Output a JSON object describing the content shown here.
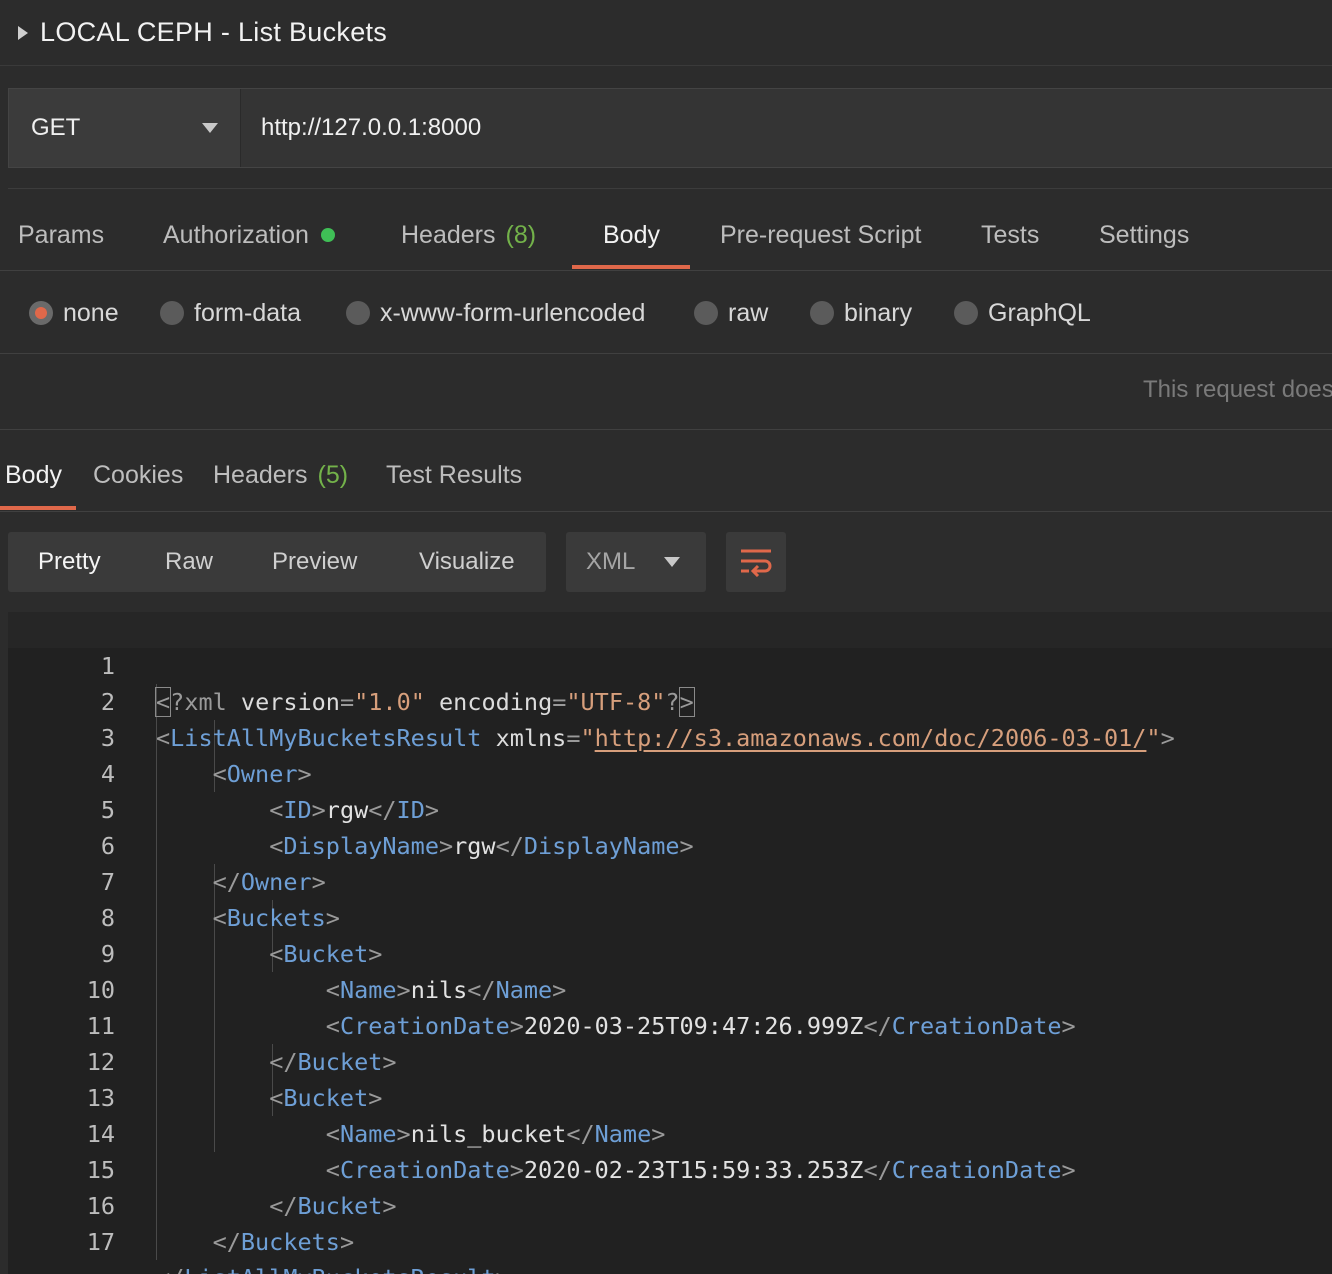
{
  "request": {
    "title": "LOCAL CEPH - List Buckets",
    "method": "GET",
    "url": "http://127.0.0.1:8000"
  },
  "request_tabs": [
    {
      "label": "Params"
    },
    {
      "label": "Authorization"
    },
    {
      "label": "Headers",
      "count": "(8)"
    },
    {
      "label": "Body"
    },
    {
      "label": "Pre-request Script"
    },
    {
      "label": "Tests"
    },
    {
      "label": "Settings"
    }
  ],
  "body_types": [
    {
      "label": "none",
      "selected": true
    },
    {
      "label": "form-data"
    },
    {
      "label": "x-www-form-urlencoded"
    },
    {
      "label": "raw"
    },
    {
      "label": "binary"
    },
    {
      "label": "GraphQL"
    }
  ],
  "body_notice": "This request does",
  "response_tabs": [
    {
      "label": "Body"
    },
    {
      "label": "Cookies"
    },
    {
      "label": "Headers",
      "count": "(5)"
    },
    {
      "label": "Test Results"
    }
  ],
  "view_modes": [
    {
      "label": "Pretty"
    },
    {
      "label": "Raw"
    },
    {
      "label": "Preview"
    },
    {
      "label": "Visualize"
    }
  ],
  "language": "XML",
  "colors": {
    "accent": "#e0684a",
    "status_green": "#3fbf56",
    "count_green": "#73b24a",
    "xml_tag": "#6e9fd6",
    "xml_string": "#d79f7c"
  },
  "icons": {
    "collapse": "caret-right-icon",
    "dropdown": "chevron-down-icon",
    "wrap": "wrap-lines-icon"
  },
  "code": {
    "line_numbers": [
      "1",
      "2",
      "3",
      "4",
      "5",
      "6",
      "7",
      "8",
      "9",
      "10",
      "11",
      "12",
      "13",
      "14",
      "15",
      "16",
      "17"
    ],
    "xml_decl": {
      "target": "xml",
      "a1": "version",
      "v1": "\"1.0\"",
      "a2": "encoding",
      "v2": "\"UTF-8\""
    },
    "root_tag": "ListAllMyBucketsResult",
    "xmlns_attr": "xmlns",
    "xmlns_url": "http://s3.amazonaws.com/doc/2006-03-01/",
    "owner_tag": "Owner",
    "id_tag": "ID",
    "owner_id": "rgw",
    "display_name_tag": "DisplayName",
    "display_name": "rgw",
    "buckets_tag": "Buckets",
    "bucket_tag": "Bucket",
    "name_tag": "Name",
    "creation_date_tag": "CreationDate",
    "buckets": [
      {
        "name": "nils",
        "creation_date": "2020-03-25T09:47:26.999Z"
      },
      {
        "name": "nils_bucket",
        "creation_date": "2020-02-23T15:59:33.253Z"
      }
    ]
  }
}
